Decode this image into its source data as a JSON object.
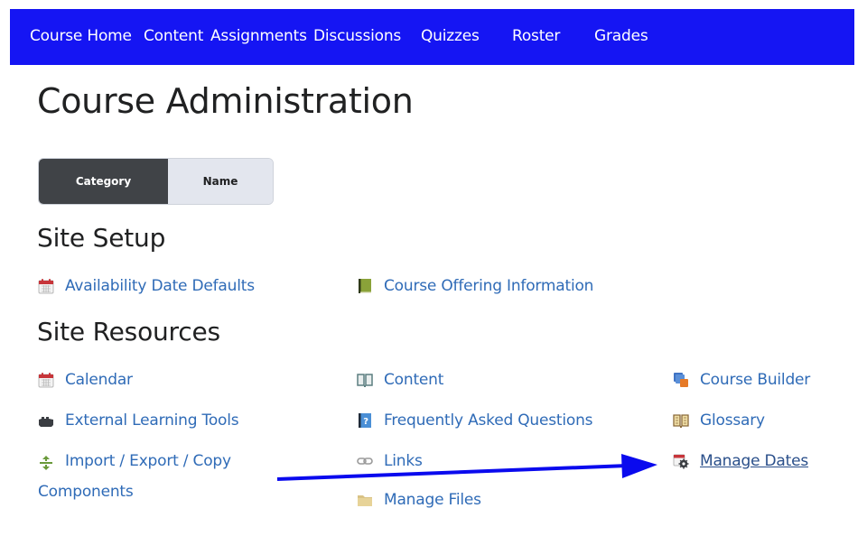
{
  "nav": {
    "items": [
      {
        "label": "Course Home"
      },
      {
        "label": "Content"
      },
      {
        "label": "Assignments"
      },
      {
        "label": "Discussions"
      },
      {
        "label": "Quizzes"
      },
      {
        "label": "Roster"
      },
      {
        "label": "Grades"
      }
    ],
    "background_color": "#1515f3"
  },
  "page": {
    "title": "Course Administration"
  },
  "view_toggle": {
    "options": [
      {
        "label": "Category",
        "selected": true
      },
      {
        "label": "Name",
        "selected": false
      }
    ]
  },
  "sections": [
    {
      "heading": "Site Setup",
      "tools": [
        {
          "label": "Availability Date Defaults",
          "icon": "calendar-icon"
        },
        {
          "label": "Course Offering Information",
          "icon": "green-book-icon"
        }
      ]
    },
    {
      "heading": "Site Resources",
      "tools": [
        {
          "label": "Calendar",
          "icon": "calendar-icon"
        },
        {
          "label": "Content",
          "icon": "open-book-icon"
        },
        {
          "label": "Course Builder",
          "icon": "cubes-icon"
        },
        {
          "label": "External Learning Tools",
          "icon": "puzzle-icon"
        },
        {
          "label": "Frequently Asked Questions",
          "icon": "faq-book-icon"
        },
        {
          "label": "Glossary",
          "icon": "glossary-book-icon"
        },
        {
          "label": "Import / Export / Copy Components",
          "icon": "import-export-icon"
        },
        {
          "label": "Links",
          "icon": "link-icon"
        },
        {
          "label": "Manage Dates",
          "icon": "calendar-gear-icon",
          "underlined": true
        },
        {
          "label": "Manage Files",
          "icon": "folder-icon"
        }
      ]
    }
  ],
  "annotation": {
    "type": "arrow",
    "from": "Import / Export / Copy Components",
    "to": "Manage Dates",
    "color": "#0a0aee"
  },
  "link_color": "#2f6bb7"
}
